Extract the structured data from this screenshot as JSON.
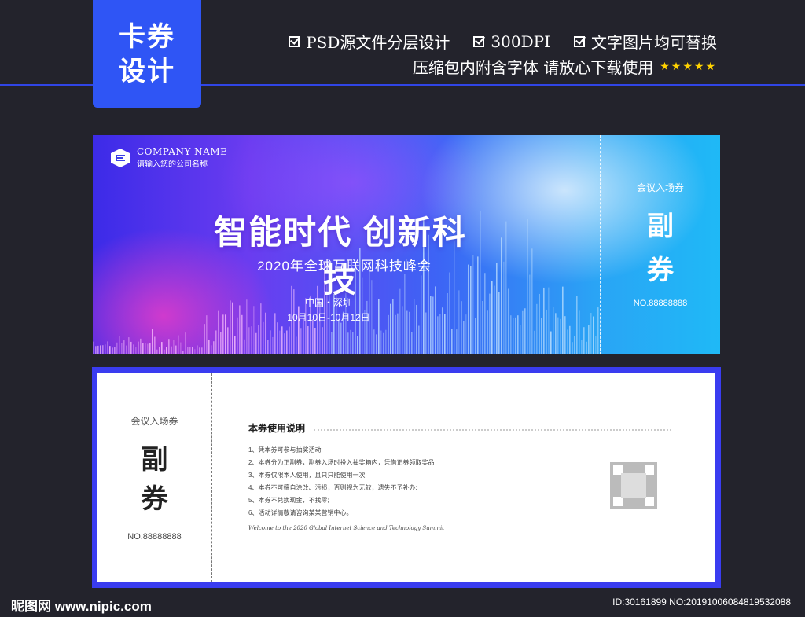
{
  "badge": {
    "line1": "卡券",
    "line2": "设计"
  },
  "features": [
    {
      "label": "PSD源文件分层设计"
    },
    {
      "label": "300DPI"
    },
    {
      "label": "文字图片均可替换"
    }
  ],
  "subline": {
    "text": "压缩包内附含字体 请放心下载使用",
    "stars": "★★★★★"
  },
  "ticket": {
    "company_name": "COMPANY NAME",
    "company_hint": "请输入您的公司名称",
    "title": "智能时代 创新科技",
    "subtitle": "2020年全球互联网科技峰会",
    "location": "中国・深圳",
    "dates": "10月10日-10月12日",
    "stub_label": "会议入场券",
    "stub_big1": "副",
    "stub_big2": "券",
    "stub_no": "NO.88888888"
  },
  "back": {
    "stub_label": "会议入场券",
    "stub_big1": "副",
    "stub_big2": "券",
    "stub_no": "NO.88888888",
    "instructions_title": "本券使用说明",
    "instructions": [
      "1、凭本券可参与抽奖活动;",
      "2、本券分为正副券，副券入场时投入抽奖箱内，凭借正券领取奖品",
      "3、本券仅限本人使用，且只只能使用一次;",
      "4、本券不可擅自涂改、污损，否则视为无效，遗失不予补办;",
      "5、本券不兑换现金，不找零;",
      "6、活动详情敬请咨询某某营销中心。"
    ],
    "welcome": "Welcome to the 2020 Global Internet Science and Technology Summit"
  },
  "footer": {
    "brand": "昵图网 www.nipic.com",
    "id": "ID:30161899 NO:20191006084819532088"
  },
  "colors": {
    "accent": "#2f55f5",
    "background": "#23232c",
    "frame": "#3a3cf0"
  }
}
